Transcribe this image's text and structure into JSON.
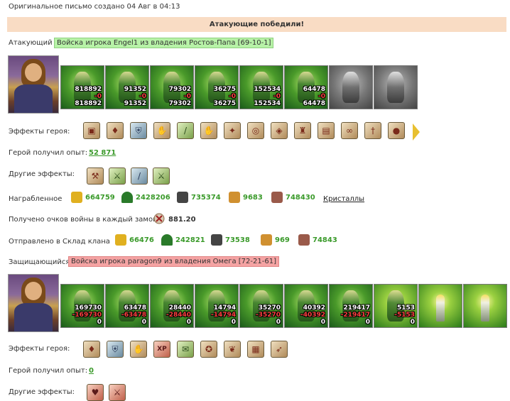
{
  "header": {
    "created": "Оригинальное письмо создано 04 Авг в 04:13"
  },
  "banner": {
    "text": "Атакующие победили!"
  },
  "attacker": {
    "label": "Атакующий",
    "army_tag": "Войска игрока Engel1 из владения Ростов-Папа [69-10-1]",
    "units": [
      {
        "icon": "mech-unit",
        "top": "818892",
        "mid": "-0",
        "bot": "818892"
      },
      {
        "icon": "knight-unit",
        "top": "91352",
        "mid": "-0",
        "bot": "91352"
      },
      {
        "icon": "paladin-unit",
        "top": "79302",
        "mid": "-0",
        "bot": "79302"
      },
      {
        "icon": "griffin-unit",
        "top": "36275",
        "mid": "-0",
        "bot": "36275"
      },
      {
        "icon": "archer-unit",
        "top": "152534",
        "mid": "-0",
        "bot": "152534"
      },
      {
        "icon": "druid-unit",
        "top": "64478",
        "mid": "-0",
        "bot": "64478"
      },
      {
        "icon": "ghost-unit",
        "top": "",
        "mid": "",
        "bot": ""
      },
      {
        "icon": "statue-unit",
        "top": "",
        "mid": "",
        "bot": ""
      }
    ],
    "effects_label": "Эффекты героя:",
    "effects": [
      "chest-icon",
      "potion-icon",
      "shield-icon",
      "glove-icon",
      "sword-icon",
      "hand-icon",
      "crystal-hand-icon",
      "bag-icon",
      "amulet-icon",
      "armor-icon",
      "tome-icon",
      "ribbon-icon",
      "dagger-icon",
      "orb-icon"
    ],
    "exp_label": "Герой получил опыт:",
    "exp_value": "52 871",
    "other_label": "Другие эффекты:",
    "other_effects": [
      "axe-icon",
      "cross-swords-icon",
      "blade-icon",
      "green-swords-icon"
    ],
    "reward_label": "Награбленное",
    "rewards": [
      {
        "icon": "gold-icon",
        "value": "664759"
      },
      {
        "icon": "wood-icon",
        "value": "2428206"
      },
      {
        "icon": "ore-icon",
        "value": "735374"
      },
      {
        "icon": "grain-icon",
        "value": "9683"
      },
      {
        "icon": "stone-icon",
        "value": "748430"
      }
    ],
    "crystals_link": "Кристаллы",
    "war_points_label": "Получено очков войны в каждый замок",
    "war_points_value": "881.20",
    "warehouse_label": "Отправлено в Склад клана",
    "warehouse": [
      {
        "icon": "gold-icon",
        "value": "66476"
      },
      {
        "icon": "wood-icon",
        "value": "242821"
      },
      {
        "icon": "ore-icon",
        "value": "73538"
      },
      {
        "icon": "grain-icon",
        "value": "969"
      },
      {
        "icon": "stone-icon",
        "value": "74843"
      }
    ]
  },
  "defender": {
    "label": "Защищающийся",
    "army_tag": "Войска игрока paragon9 из владения Омега [72-21-61]",
    "units": [
      {
        "icon": "mech-unit",
        "top": "169730",
        "mid": "-169730",
        "bot": "0"
      },
      {
        "icon": "knight-unit",
        "top": "63478",
        "mid": "-63478",
        "bot": "0"
      },
      {
        "icon": "paladin-unit",
        "top": "28440",
        "mid": "-28440",
        "bot": "0"
      },
      {
        "icon": "griffin-unit",
        "top": "14794",
        "mid": "-14794",
        "bot": "0"
      },
      {
        "icon": "archer-unit",
        "top": "35270",
        "mid": "-35270",
        "bot": "0"
      },
      {
        "icon": "druid-unit",
        "top": "40392",
        "mid": "-40392",
        "bot": "0"
      },
      {
        "icon": "wizard-unit",
        "top": "219417",
        "mid": "-219417",
        "bot": "0"
      },
      {
        "icon": "shaman-unit",
        "top": "5153",
        "mid": "-5153",
        "bot": "0"
      },
      {
        "icon": "tower-unit",
        "top": "",
        "mid": "",
        "bot": ""
      },
      {
        "icon": "tower-unit",
        "top": "",
        "mid": "",
        "bot": ""
      }
    ],
    "effects_label": "Эффекты героя:",
    "effects": [
      "potion-icon",
      "shield-icon",
      "glove-icon",
      "xp-icon",
      "scroll-icon",
      "pentagram-icon",
      "moth-icon",
      "map-icon",
      "bow-icon"
    ],
    "xp_text": "XP",
    "exp_label": "Герой получил опыт:",
    "exp_value": "0",
    "other_label": "Другие эффекты:",
    "other_effects": [
      "heart-icon",
      "broken-sword-icon"
    ]
  }
}
